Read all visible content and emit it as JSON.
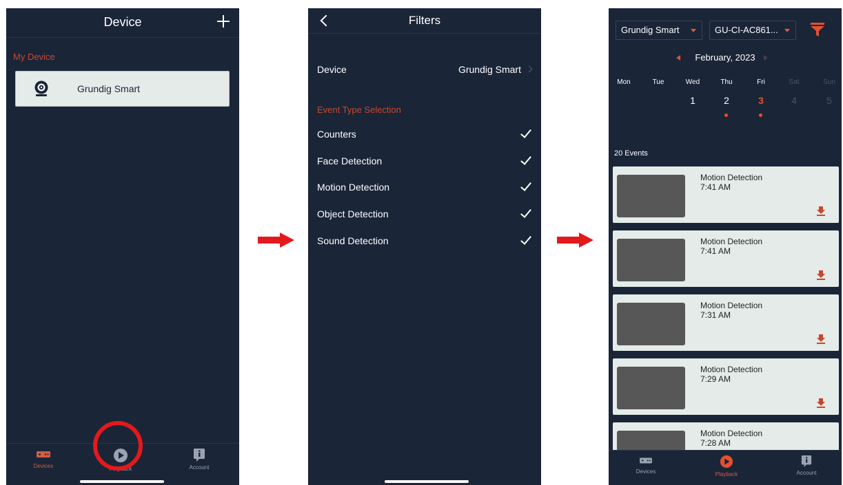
{
  "panel1": {
    "title": "Device",
    "section_label": "My Device",
    "device_name": "Grundig Smart",
    "tabs": [
      {
        "label": "Devices",
        "icon": "devices-icon"
      },
      {
        "label": "Playback",
        "icon": "playback-icon"
      },
      {
        "label": "Account",
        "icon": "account-icon"
      }
    ]
  },
  "panel2": {
    "title": "Filters",
    "device_label": "Device",
    "device_value": "Grundig Smart",
    "section_label": "Event Type Selection",
    "event_types": [
      {
        "label": "Counters",
        "checked": true
      },
      {
        "label": "Face Detection",
        "checked": true
      },
      {
        "label": "Motion Detection",
        "checked": true
      },
      {
        "label": "Object Detection",
        "checked": true
      },
      {
        "label": "Sound Detection",
        "checked": true
      }
    ]
  },
  "panel3": {
    "device_select": "Grundig Smart",
    "camera_select": "GU-CI-AC861...",
    "month": "February, 2023",
    "weekdays": [
      "Mon",
      "Tue",
      "Wed",
      "Thu",
      "Fri",
      "Sat",
      "Sun"
    ],
    "days": [
      "1",
      "2",
      "3",
      "4",
      "5"
    ],
    "selected_day": "3",
    "event_count": "20 Events",
    "events": [
      {
        "title": "Motion Detection",
        "time": "7:41 AM"
      },
      {
        "title": "Motion Detection",
        "time": "7:41 AM"
      },
      {
        "title": "Motion Detection",
        "time": "7:31 AM"
      },
      {
        "title": "Motion Detection",
        "time": "7:29 AM"
      },
      {
        "title": "Motion Detection",
        "time": "7:28 AM"
      }
    ],
    "tabs": [
      {
        "label": "Devices",
        "icon": "devices-icon"
      },
      {
        "label": "Playback",
        "icon": "playback-icon"
      },
      {
        "label": "Account",
        "icon": "account-icon"
      }
    ]
  },
  "colors": {
    "background": "#1b2538",
    "accent": "#d25e41",
    "arrow": "#e3191b",
    "card": "#e5ebe8"
  }
}
